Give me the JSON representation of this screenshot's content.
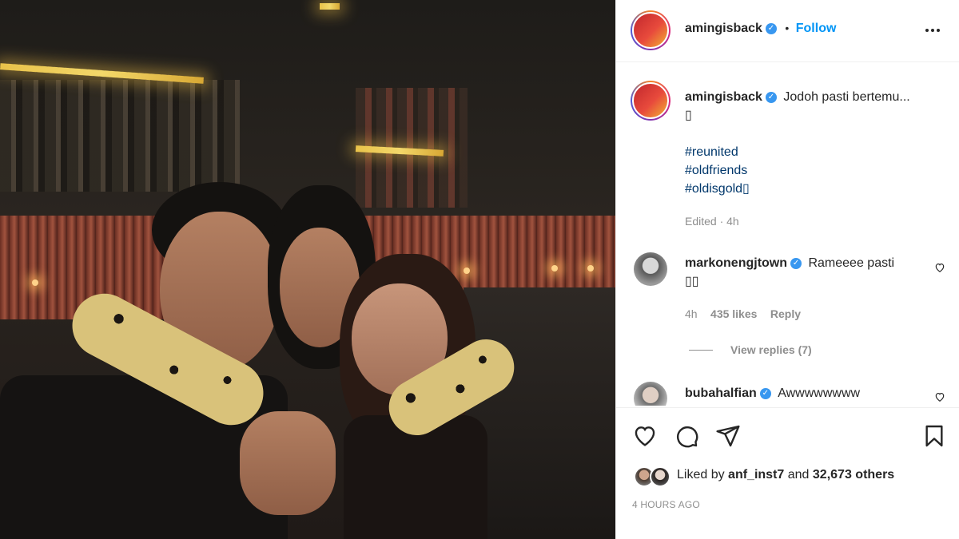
{
  "post_header": {
    "username": "amingisback",
    "follow_label": "Follow",
    "separator": "•",
    "more_icon": "more-horizontal-icon"
  },
  "caption": {
    "username": "amingisback",
    "text": "Jodoh pasti bertemu...",
    "emoji_line": "▯",
    "hashtags": [
      "#reunited",
      "#oldfriends",
      "#oldisgold▯"
    ],
    "meta": "Edited · 4h"
  },
  "comments": [
    {
      "username": "markonengjtown",
      "text": "Rameeee pasti",
      "emoji_line": "▯▯",
      "time": "4h",
      "likes": "435 likes",
      "reply_label": "Reply",
      "view_replies": "View replies (7)"
    },
    {
      "username": "bubahalfian",
      "text": "Awwwwwwww"
    }
  ],
  "actions": {
    "like_icon": "heart-icon",
    "comment_icon": "comment-icon",
    "share_icon": "share-icon",
    "save_icon": "bookmark-icon"
  },
  "likes": {
    "prefix": "Liked by",
    "user": "anf_inst7",
    "suffix": "and",
    "others": "32,673 others"
  },
  "timestamp": "4 HOURS AGO",
  "colors": {
    "link_blue": "#0095f6",
    "verified_blue": "#3897f0",
    "hashtag": "#00376b",
    "muted": "#8e8e8e"
  }
}
